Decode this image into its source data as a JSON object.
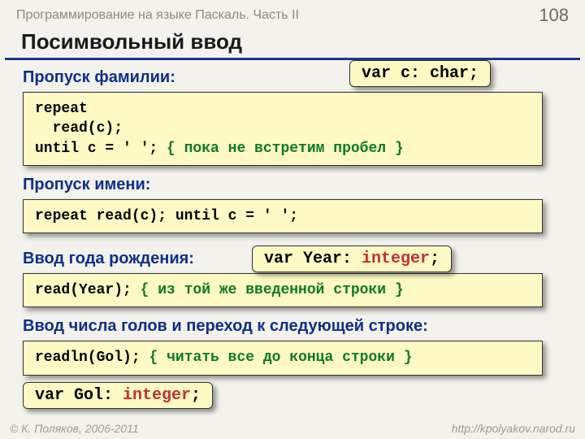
{
  "header": {
    "course": "Программирование на языке Паскаль. Часть II",
    "page": "108"
  },
  "title": "Посимвольный ввод",
  "sections": {
    "skip_surname": {
      "heading": "Пропуск фамилии:",
      "code_l1": "repeat",
      "code_l2": "  read(c);",
      "code_l3a": "until c = ' '; ",
      "code_l3b": "{ пока не встретим пробел }",
      "callout": "var c: char;"
    },
    "skip_name": {
      "heading": "Пропуск имени:",
      "code": "repeat read(c); until c = ' ';"
    },
    "year": {
      "heading": "Ввод года рождения:",
      "code_a": "read(Year); ",
      "code_b": "{ из той же введенной строки }",
      "callout_a": "var Year: ",
      "callout_b": "integer",
      "callout_c": ";"
    },
    "gol": {
      "heading": "Ввод числа голов и переход к следующей строке:",
      "code_a": "readln(Gol); ",
      "code_b": "{ читать все до конца строки }",
      "callout_a": "var Gol: ",
      "callout_b": "integer",
      "callout_c": ";"
    }
  },
  "footer": {
    "copyright": "© К. Поляков, 2006-2011",
    "url": "http://kpolyakov.narod.ru"
  }
}
